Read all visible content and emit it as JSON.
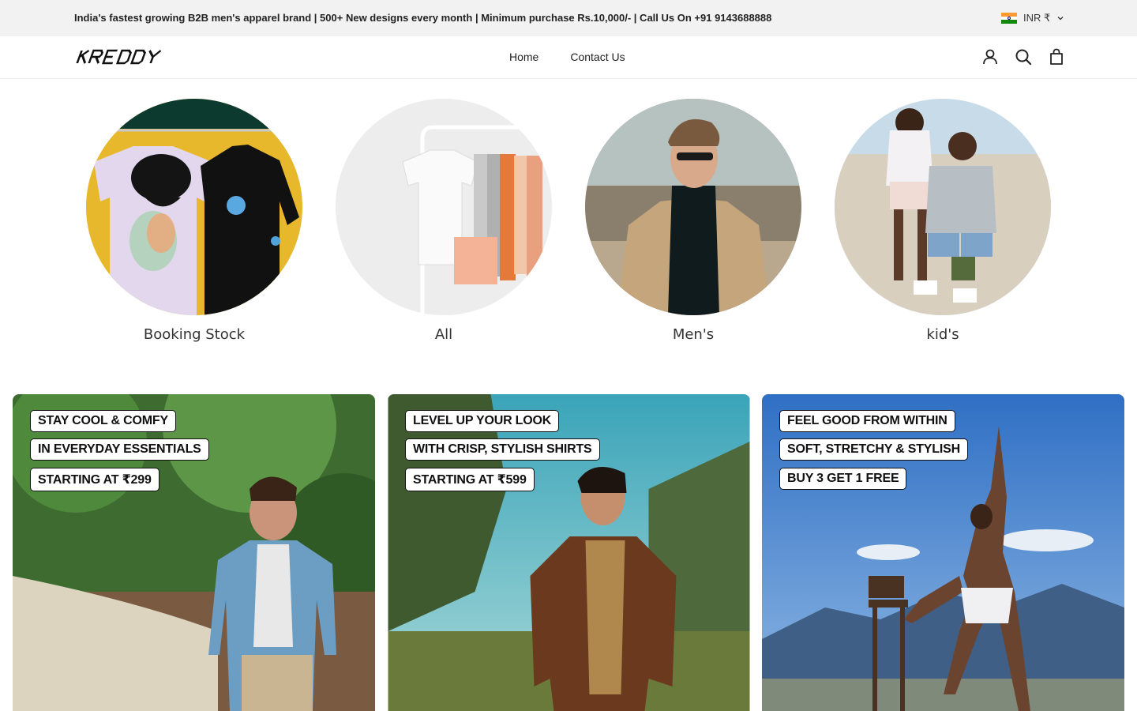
{
  "announcement": {
    "text": "India's fastest growing B2B men's apparel brand | 500+ New designs every month | Minimum purchase Rs.10,000/- | Call Us On +91 9143688888",
    "currency": "INR ₹"
  },
  "header": {
    "logo_text": "KREDDY",
    "nav": [
      "Home",
      "Contact Us"
    ],
    "icons": [
      "account-icon",
      "search-icon",
      "cart-icon"
    ]
  },
  "categories": [
    {
      "label": "Booking Stock"
    },
    {
      "label": "All"
    },
    {
      "label": "Men's"
    },
    {
      "label": "kid's"
    }
  ],
  "banners": [
    {
      "lines": [
        "STAY COOL & COMFY",
        "IN EVERYDAY ESSENTIALS",
        "STARTING AT ₹299"
      ]
    },
    {
      "lines": [
        "LEVEL UP YOUR LOOK",
        "WITH CRISP, STYLISH SHIRTS",
        "STARTING AT ₹599"
      ]
    },
    {
      "lines": [
        "FEEL GOOD FROM WITHIN",
        "SOFT, STRETCHY & STYLISH",
        "BUY 3 GET 1 FREE"
      ]
    }
  ],
  "colors": {
    "announcement_bg": "#f2f2f2",
    "text": "#222222"
  }
}
